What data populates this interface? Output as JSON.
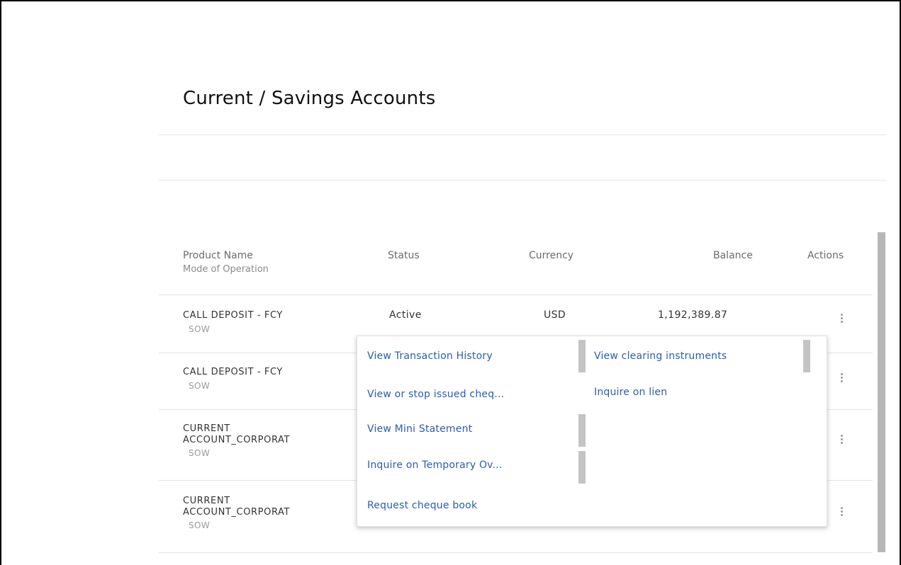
{
  "page": {
    "title": "Current / Savings Accounts"
  },
  "table": {
    "headers": {
      "product_name": "Product Name",
      "mode_of_operation": "Mode of Operation",
      "status": "Status",
      "currency": "Currency",
      "balance": "Balance",
      "actions": "Actions"
    },
    "rows": [
      {
        "product_line1": "CALL DEPOSIT - FCY",
        "product_line2": "",
        "mode": "SOW",
        "status": "Active",
        "currency": "USD",
        "balance": "1,192,389.87"
      },
      {
        "product_line1": "CALL DEPOSIT - FCY",
        "product_line2": "",
        "mode": "SOW",
        "status": "",
        "currency": "",
        "balance": ""
      },
      {
        "product_line1": "CURRENT",
        "product_line2": "ACCOUNT_CORPORAT",
        "mode": "SOW",
        "status": "",
        "currency": "",
        "balance": ""
      },
      {
        "product_line1": "CURRENT",
        "product_line2": "ACCOUNT_CORPORAT",
        "mode": "SOW",
        "status": "",
        "currency": "",
        "balance": ""
      }
    ]
  },
  "actions_menu": {
    "left_items": [
      "View Transaction History",
      "View or stop issued cheq...",
      "View Mini Statement",
      "Inquire on Temporary Ov...",
      "Request cheque book"
    ],
    "right_items": [
      "View clearing instruments",
      "Inquire on lien"
    ]
  },
  "icons": {
    "row_actions": "kebab-menu-icon"
  },
  "colors": {
    "link": "#2a5db0",
    "scrollbar": "#b7b7b7"
  }
}
